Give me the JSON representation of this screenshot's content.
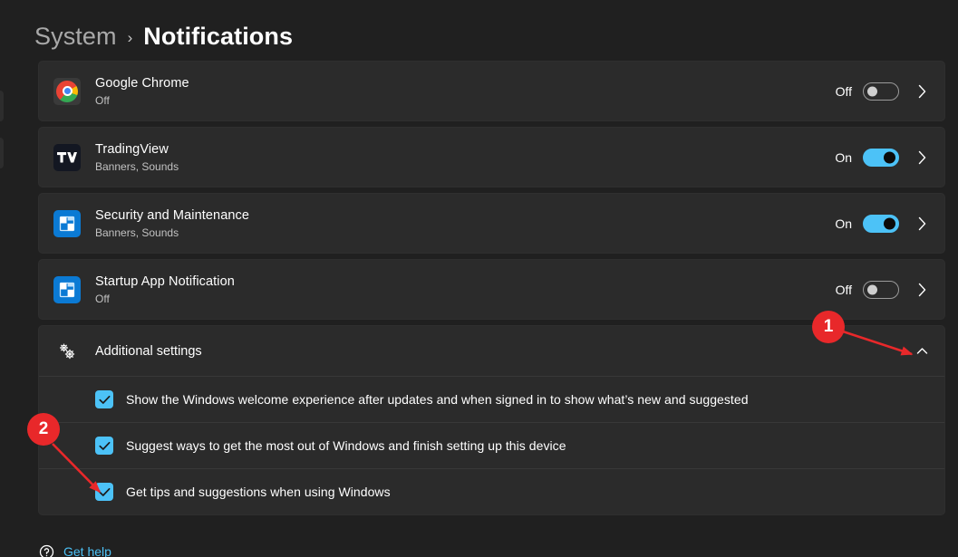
{
  "breadcrumb": {
    "parent": "System",
    "separator": "›",
    "current": "Notifications"
  },
  "colors": {
    "page_background": "#202020",
    "card_background": "#2b2b2b",
    "accent_blue": "#4cc2f7",
    "link_blue": "#4cc2f7",
    "annotation_red": "#e8282a",
    "muted_text": "#c2c2c2"
  },
  "apps": [
    {
      "name": "Google Chrome",
      "status": "Off",
      "toggle_label": "Off",
      "toggle_state": "off",
      "icon": "chrome-icon"
    },
    {
      "name": "TradingView",
      "status": "Banners, Sounds",
      "toggle_label": "On",
      "toggle_state": "on",
      "icon": "tradingview-icon"
    },
    {
      "name": "Security and Maintenance",
      "status": "Banners, Sounds",
      "toggle_label": "On",
      "toggle_state": "on",
      "icon": "windows-tile-icon"
    },
    {
      "name": "Startup App Notification",
      "status": "Off",
      "toggle_label": "Off",
      "toggle_state": "off",
      "icon": "windows-tile-icon"
    }
  ],
  "additional_settings": {
    "label": "Additional settings",
    "icon": "gears-icon",
    "expanded": true,
    "chevron": "chevron-up-icon",
    "options": [
      {
        "label": "Show the Windows welcome experience after updates and when signed in to show what’s new and suggested",
        "checked": true
      },
      {
        "label": "Suggest ways to get the most out of Windows and finish setting up this device",
        "checked": true
      },
      {
        "label": "Get tips and suggestions when using Windows",
        "checked": true
      }
    ]
  },
  "get_help": {
    "label": "Get help",
    "icon": "help-icon"
  },
  "annotations": [
    {
      "number": "1",
      "target": "additional-settings-chevron"
    },
    {
      "number": "2",
      "target": "get-tips-checkbox"
    }
  ]
}
